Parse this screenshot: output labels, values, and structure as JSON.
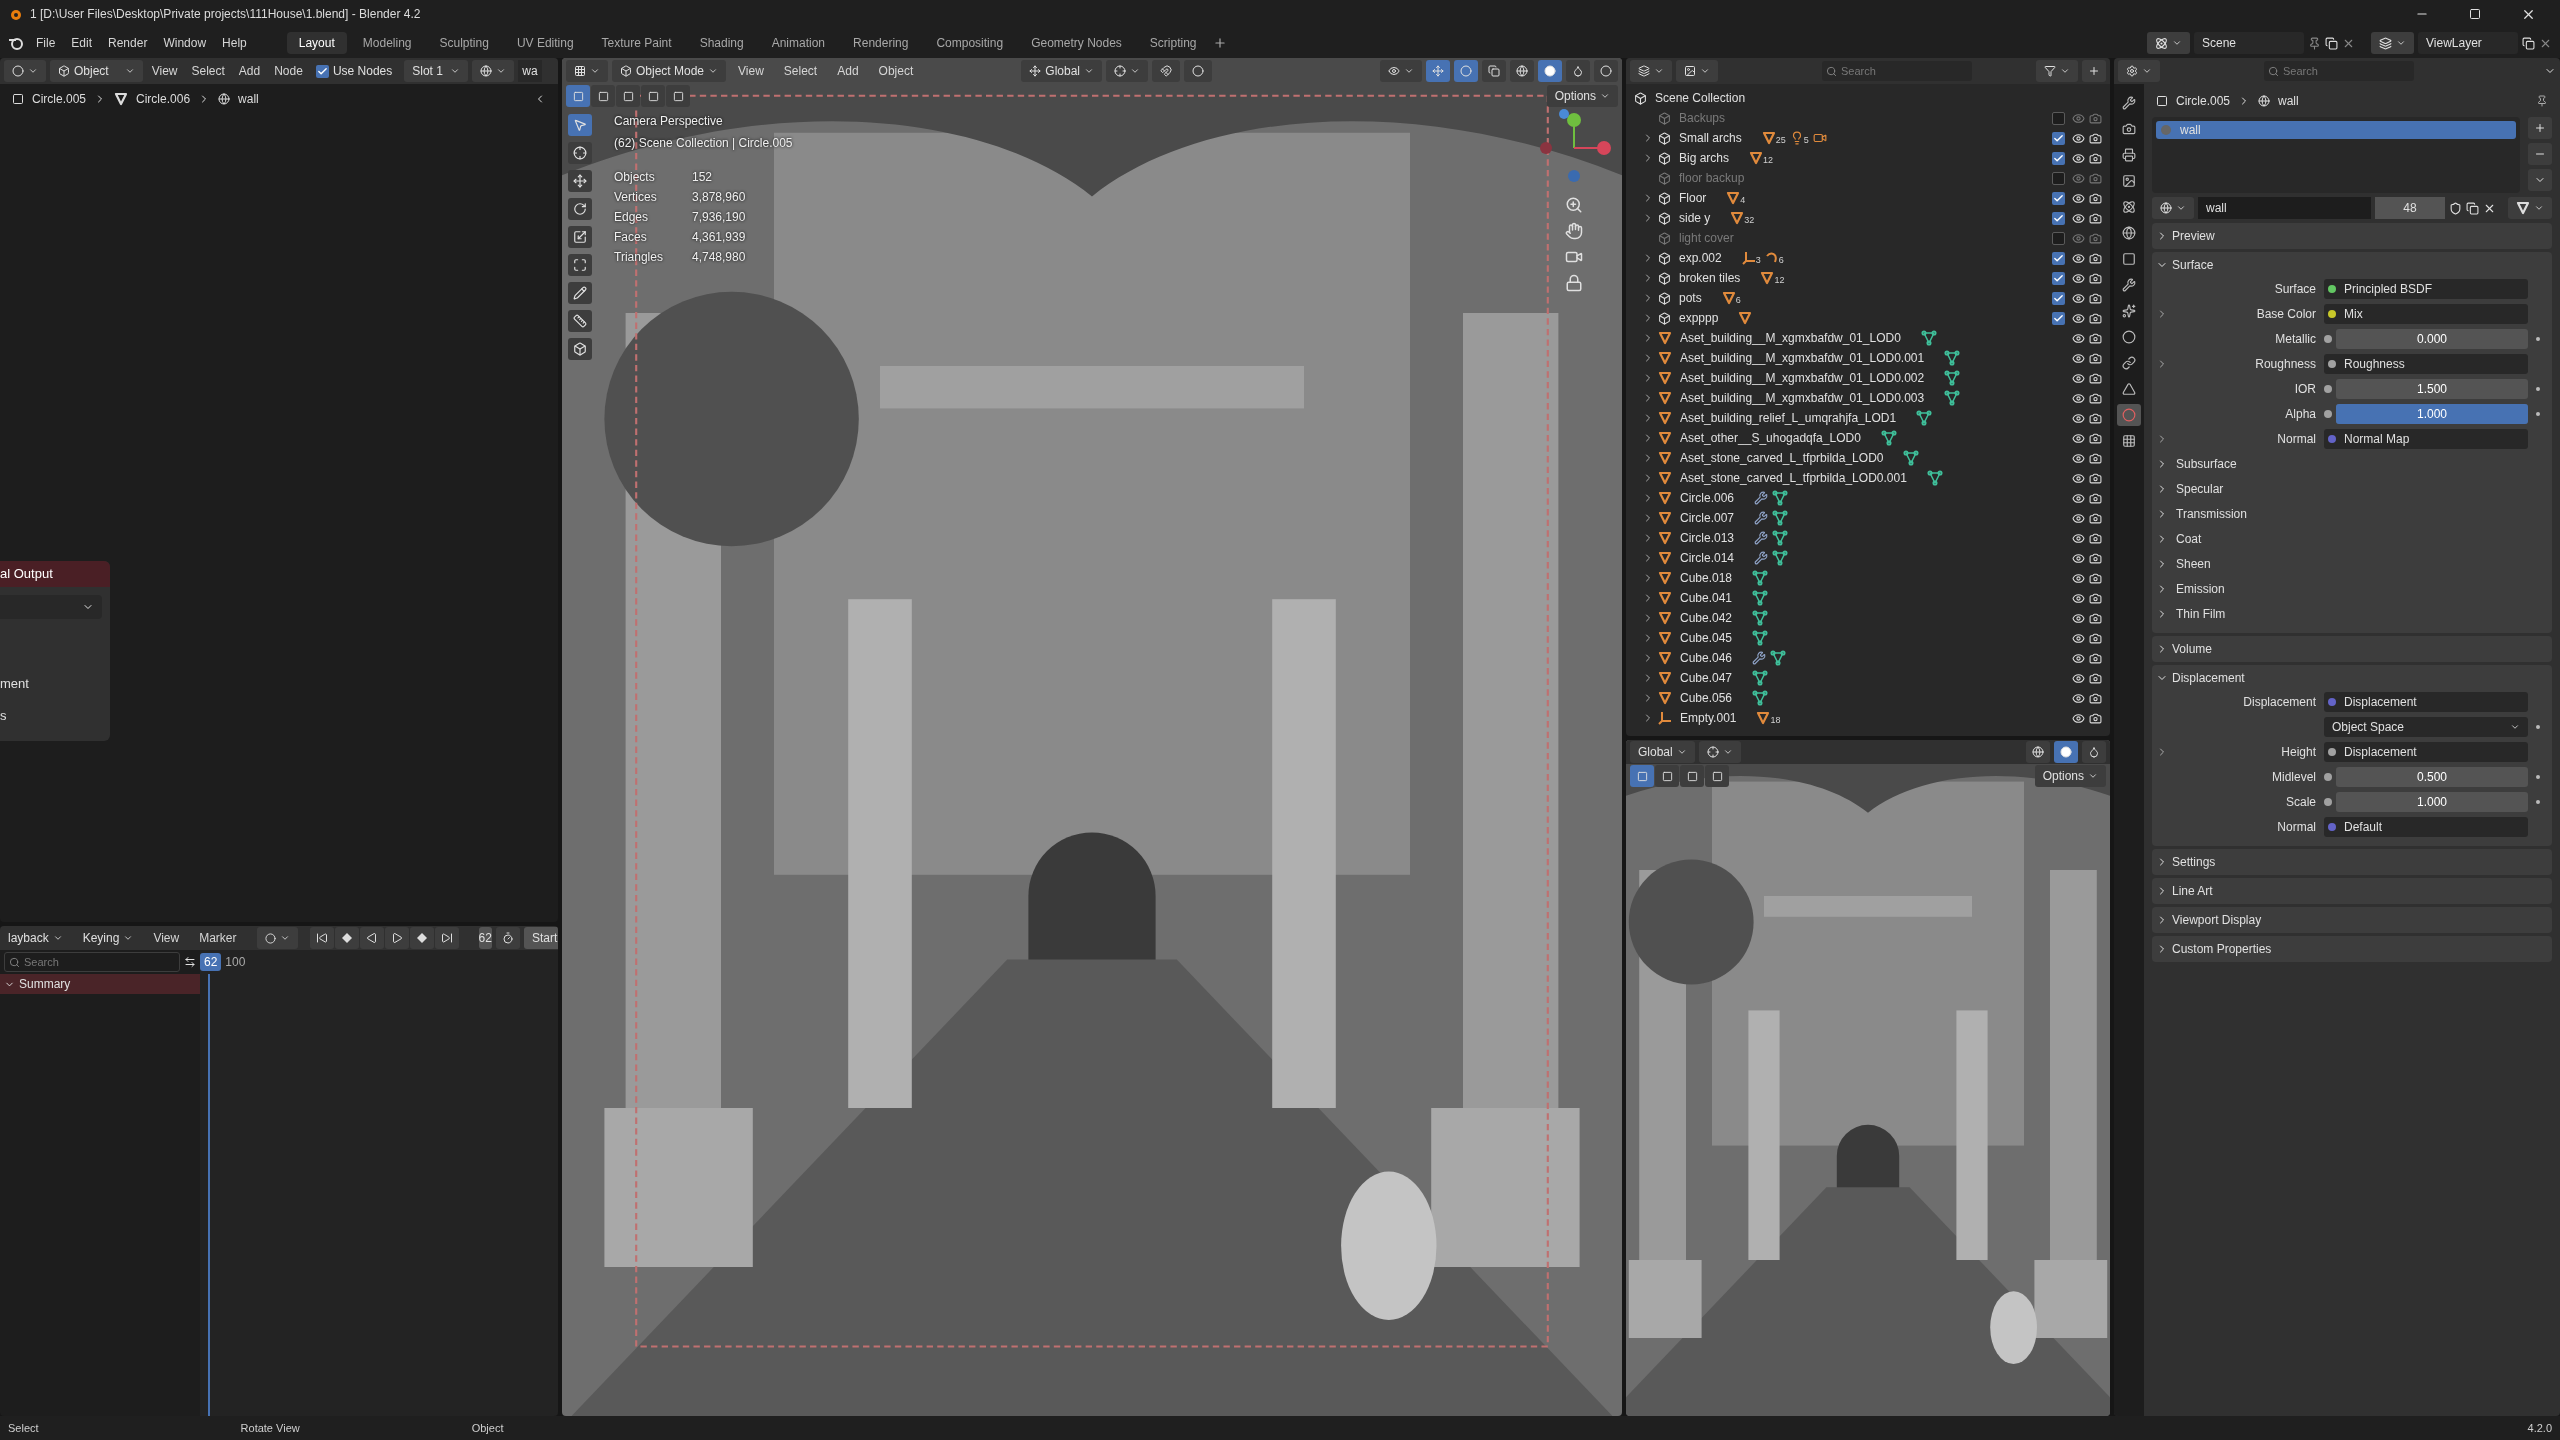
{
  "title_bar": {
    "title": "1 [D:\\User Files\\Desktop\\Private projects\\111House\\1.blend] - Blender 4.2"
  },
  "menu": [
    "File",
    "Edit",
    "Render",
    "Window",
    "Help"
  ],
  "workspaces": [
    {
      "label": "Layout",
      "selected": true
    },
    {
      "label": "Modeling",
      "selected": false
    },
    {
      "label": "Sculpting",
      "selected": false
    },
    {
      "label": "UV Editing",
      "selected": false
    },
    {
      "label": "Texture Paint",
      "selected": false
    },
    {
      "label": "Shading",
      "selected": false
    },
    {
      "label": "Animation",
      "selected": false
    },
    {
      "label": "Rendering",
      "selected": false
    },
    {
      "label": "Compositing",
      "selected": false
    },
    {
      "label": "Geometry Nodes",
      "selected": false
    },
    {
      "label": "Scripting",
      "selected": false
    }
  ],
  "scene": {
    "scene": "Scene",
    "view_layer": "ViewLayer"
  },
  "node_editor": {
    "mode": "Object",
    "menus": [
      "View",
      "Select",
      "Add",
      "Node"
    ],
    "use_nodes": {
      "label": "Use Nodes",
      "checked": true
    },
    "slot": "Slot 1",
    "material": "wa",
    "breadcrumb": [
      "Circle.005",
      "Circle.006",
      "wall"
    ],
    "node": {
      "title": "al Output",
      "rows": [
        "ment",
        "s"
      ]
    }
  },
  "timeline": {
    "menus": [
      "layback",
      "Keying",
      "View",
      "Marker"
    ],
    "auto_keying": {
      "on": false
    },
    "frame": "62",
    "start": "Start",
    "search": {
      "placeholder": "Search"
    },
    "playhead": "62",
    "ruler": [
      "100"
    ],
    "channels": [
      "Summary"
    ]
  },
  "viewport": {
    "mode": "Object Mode",
    "menus": [
      "View",
      "Select",
      "Add",
      "Object"
    ],
    "orientation": "Global",
    "options": "Options",
    "toggles": [
      {
        "kind": "gizmo",
        "on": true
      },
      {
        "kind": "overlay",
        "on": true
      },
      {
        "kind": "xray",
        "on": false
      }
    ],
    "shading": [
      {
        "kind": "wireframe",
        "selected": false
      },
      {
        "kind": "solid",
        "selected": true
      },
      {
        "kind": "material",
        "selected": false
      },
      {
        "kind": "rendered",
        "selected": false
      }
    ],
    "select_modes": [
      {
        "selected": true
      },
      {
        "selected": false
      },
      {
        "selected": false
      },
      {
        "selected": false
      },
      {
        "selected": false
      }
    ],
    "tools": [
      {
        "kind": "select_box",
        "selected": true
      },
      {
        "kind": "cursor",
        "selected": false
      },
      {
        "kind": "move",
        "selected": false
      },
      {
        "kind": "rotate",
        "selected": false
      },
      {
        "kind": "scale",
        "selected": false
      },
      {
        "kind": "transform",
        "selected": false
      },
      {
        "kind": "annotate",
        "selected": false
      },
      {
        "kind": "measure",
        "selected": false
      },
      {
        "kind": "add_cube",
        "selected": false
      }
    ],
    "overlay": {
      "title": "Camera Perspective",
      "context": "(62) Scene Collection | Circle.005",
      "stats": [
        {
          "label": "Objects",
          "value": "152"
        },
        {
          "label": "Vertices",
          "value": "3,878,960"
        },
        {
          "label": "Edges",
          "value": "7,936,190"
        },
        {
          "label": "Faces",
          "value": "4,361,939"
        },
        {
          "label": "Triangles",
          "value": "4,748,980"
        }
      ]
    }
  },
  "outliner": {
    "search": {
      "placeholder": "Search"
    },
    "root": "Scene Collection",
    "items": [
      {
        "name": "Backups",
        "kind": "collection",
        "checked": false,
        "expandable": false
      },
      {
        "name": "Small archs",
        "kind": "collection",
        "checked": true,
        "expandable": true,
        "badges": [
          {
            "kind": "mesh",
            "count": "25"
          },
          {
            "kind": "light",
            "count": "5"
          },
          {
            "kind": "camera"
          }
        ]
      },
      {
        "name": "Big archs",
        "kind": "collection",
        "checked": true,
        "expandable": true,
        "badges": [
          {
            "kind": "mesh",
            "count": "12"
          }
        ]
      },
      {
        "name": "floor backup",
        "kind": "collection",
        "checked": false,
        "expandable": false
      },
      {
        "name": "Floor",
        "kind": "collection",
        "checked": true,
        "expandable": true,
        "badges": [
          {
            "kind": "mesh",
            "count": "4"
          }
        ]
      },
      {
        "name": "side y",
        "kind": "collection",
        "checked": true,
        "expandable": true,
        "badges": [
          {
            "kind": "mesh",
            "count": "32"
          }
        ]
      },
      {
        "name": "light cover",
        "kind": "collection",
        "checked": false,
        "expandable": false
      },
      {
        "name": "exp.002",
        "kind": "collection",
        "checked": true,
        "expandable": true,
        "badges": [
          {
            "kind": "empty",
            "count": "3"
          },
          {
            "kind": "curve",
            "count": "6"
          }
        ]
      },
      {
        "name": "broken tiles",
        "kind": "collection",
        "checked": true,
        "expandable": true,
        "badges": [
          {
            "kind": "mesh",
            "count": "12"
          }
        ]
      },
      {
        "name": "pots",
        "kind": "collection",
        "checked": true,
        "expandable": true,
        "badges": [
          {
            "kind": "mesh",
            "count": "6"
          }
        ]
      },
      {
        "name": "expppp",
        "kind": "collection",
        "checked": true,
        "expandable": true,
        "badges": [
          {
            "kind": "mesh"
          }
        ]
      },
      {
        "name": "Aset_building__M_xgmxbafdw_01_LOD0",
        "kind": "mesh",
        "expandable": true,
        "badges": [
          {
            "kind": "meshdata"
          }
        ]
      },
      {
        "name": "Aset_building__M_xgmxbafdw_01_LOD0.001",
        "kind": "mesh",
        "expandable": true,
        "badges": [
          {
            "kind": "meshdata"
          }
        ]
      },
      {
        "name": "Aset_building__M_xgmxbafdw_01_LOD0.002",
        "kind": "mesh",
        "expandable": true,
        "badges": [
          {
            "kind": "meshdata"
          }
        ]
      },
      {
        "name": "Aset_building__M_xgmxbafdw_01_LOD0.003",
        "kind": "mesh",
        "expandable": true,
        "badges": [
          {
            "kind": "meshdata"
          }
        ]
      },
      {
        "name": "Aset_building_relief_L_umqrahjfa_LOD1",
        "kind": "mesh",
        "expandable": true,
        "badges": [
          {
            "kind": "meshdata"
          }
        ]
      },
      {
        "name": "Aset_other__S_uhogadqfa_LOD0",
        "kind": "mesh",
        "expandable": true,
        "badges": [
          {
            "kind": "meshdata"
          }
        ]
      },
      {
        "name": "Aset_stone_carved_L_tfprbilda_LOD0",
        "kind": "mesh",
        "expandable": true,
        "badges": [
          {
            "kind": "meshdata"
          }
        ]
      },
      {
        "name": "Aset_stone_carved_L_tfprbilda_LOD0.001",
        "kind": "mesh",
        "expandable": true,
        "badges": [
          {
            "kind": "meshdata"
          }
        ]
      },
      {
        "name": "Circle.006",
        "kind": "mesh",
        "expandable": true,
        "badges": [
          {
            "kind": "modifier"
          },
          {
            "kind": "meshdata"
          }
        ]
      },
      {
        "name": "Circle.007",
        "kind": "mesh",
        "expandable": true,
        "badges": [
          {
            "kind": "modifier"
          },
          {
            "kind": "meshdata"
          }
        ]
      },
      {
        "name": "Circle.013",
        "kind": "mesh",
        "expandable": true,
        "badges": [
          {
            "kind": "modifier"
          },
          {
            "kind": "meshdata"
          }
        ]
      },
      {
        "name": "Circle.014",
        "kind": "mesh",
        "expandable": true,
        "badges": [
          {
            "kind": "modifier"
          },
          {
            "kind": "meshdata"
          }
        ]
      },
      {
        "name": "Cube.018",
        "kind": "mesh",
        "expandable": true,
        "badges": [
          {
            "kind": "meshdata"
          }
        ]
      },
      {
        "name": "Cube.041",
        "kind": "mesh",
        "expandable": true,
        "badges": [
          {
            "kind": "meshdata"
          }
        ]
      },
      {
        "name": "Cube.042",
        "kind": "mesh",
        "expandable": true,
        "badges": [
          {
            "kind": "meshdata"
          }
        ]
      },
      {
        "name": "Cube.045",
        "kind": "mesh",
        "expandable": true,
        "badges": [
          {
            "kind": "meshdata"
          }
        ]
      },
      {
        "name": "Cube.046",
        "kind": "mesh",
        "expandable": true,
        "badges": [
          {
            "kind": "modifier"
          },
          {
            "kind": "meshdata"
          }
        ]
      },
      {
        "name": "Cube.047",
        "kind": "mesh",
        "expandable": true,
        "badges": [
          {
            "kind": "meshdata"
          }
        ]
      },
      {
        "name": "Cube.056",
        "kind": "mesh",
        "expandable": true,
        "badges": [
          {
            "kind": "meshdata"
          }
        ]
      },
      {
        "name": "Empty.001",
        "kind": "empty",
        "expandable": true,
        "badges": [
          {
            "kind": "mesh",
            "count": "18"
          }
        ]
      }
    ]
  },
  "viewport_2": {
    "orientation": "Global",
    "options": "Options",
    "shading": [
      {
        "kind": "wireframe",
        "selected": false
      },
      {
        "kind": "solid",
        "selected": true
      },
      {
        "kind": "material",
        "selected": false
      }
    ],
    "select_modes": [
      {
        "selected": true
      },
      {
        "selected": false
      },
      {
        "selected": false
      },
      {
        "selected": false
      }
    ]
  },
  "properties": {
    "search": {
      "placeholder": "Search"
    },
    "tabs": [
      {
        "kind": "tool",
        "selected": false
      },
      {
        "kind": "render",
        "selected": false
      },
      {
        "kind": "output",
        "selected": false
      },
      {
        "kind": "view_layer",
        "selected": false
      },
      {
        "kind": "scene",
        "selected": false
      },
      {
        "kind": "world",
        "selected": false
      },
      {
        "kind": "object",
        "selected": false
      },
      {
        "kind": "modifiers",
        "selected": false
      },
      {
        "kind": "particles",
        "selected": false
      },
      {
        "kind": "physics",
        "selected": false
      },
      {
        "kind": "constraints",
        "selected": false
      },
      {
        "kind": "data",
        "selected": false
      },
      {
        "kind": "material",
        "selected": true
      },
      {
        "kind": "texture",
        "selected": false
      }
    ],
    "breadcrumb": [
      "Circle.005",
      "wall"
    ],
    "slots": [
      {
        "name": "wall",
        "selected": true
      }
    ],
    "material": {
      "name": "wall",
      "users": "48"
    },
    "panels": [
      {
        "title": "Preview",
        "expanded": false
      },
      {
        "title": "Surface",
        "expanded": true,
        "rows": [
          {
            "label": "Surface",
            "kind": "link",
            "value": "Principled BSDF",
            "color": "#63c763",
            "expandable": false
          },
          {
            "label": "Base Color",
            "kind": "link",
            "value": "Mix",
            "color": "#c7c729",
            "expandable": true
          },
          {
            "label": "Metallic",
            "kind": "value",
            "value": "0.000",
            "color": "#a1a1a1",
            "expandable": false
          },
          {
            "label": "Roughness",
            "kind": "link",
            "value": "Roughness",
            "color": "#a1a1a1",
            "expandable": true
          },
          {
            "label": "IOR",
            "kind": "value",
            "value": "1.500",
            "color": "#a1a1a1",
            "expandable": false
          },
          {
            "label": "Alpha",
            "kind": "value",
            "value": "1.000",
            "color": "#a1a1a1",
            "expandable": false,
            "level": 1
          },
          {
            "label": "Normal",
            "kind": "link",
            "value": "Normal Map",
            "color": "#6363c7",
            "expandable": true
          }
        ],
        "subpanels": [
          "Subsurface",
          "Specular",
          "Transmission",
          "Coat",
          "Sheen",
          "Emission",
          "Thin Film"
        ]
      },
      {
        "title": "Volume",
        "expanded": false
      },
      {
        "title": "Displacement",
        "expanded": true,
        "rows": [
          {
            "label": "Displacement",
            "kind": "link",
            "value": "Displacement",
            "color": "#6363c7",
            "expandable": false
          },
          {
            "kind": "dropdown",
            "value": "Object Space",
            "expandable": false
          },
          {
            "label": "Height",
            "kind": "link",
            "value": "Displacement",
            "color": "#a1a1a1",
            "expandable": true
          },
          {
            "label": "Midlevel",
            "kind": "value",
            "value": "0.500",
            "color": "#a1a1a1",
            "expandable": false
          },
          {
            "label": "Scale",
            "kind": "value",
            "value": "1.000",
            "color": "#a1a1a1",
            "expandable": false
          },
          {
            "label": "Normal",
            "kind": "link",
            "value": "Default",
            "color": "#6363c7",
            "expandable": false
          }
        ]
      },
      {
        "title": "Settings",
        "expanded": false
      },
      {
        "title": "Line Art",
        "expanded": false
      },
      {
        "title": "Viewport Display",
        "expanded": false
      },
      {
        "title": "Custom Properties",
        "expanded": false
      }
    ]
  },
  "status_bar": {
    "items": [
      "Select",
      "Rotate View",
      "Object"
    ],
    "version": "4.2.0"
  }
}
